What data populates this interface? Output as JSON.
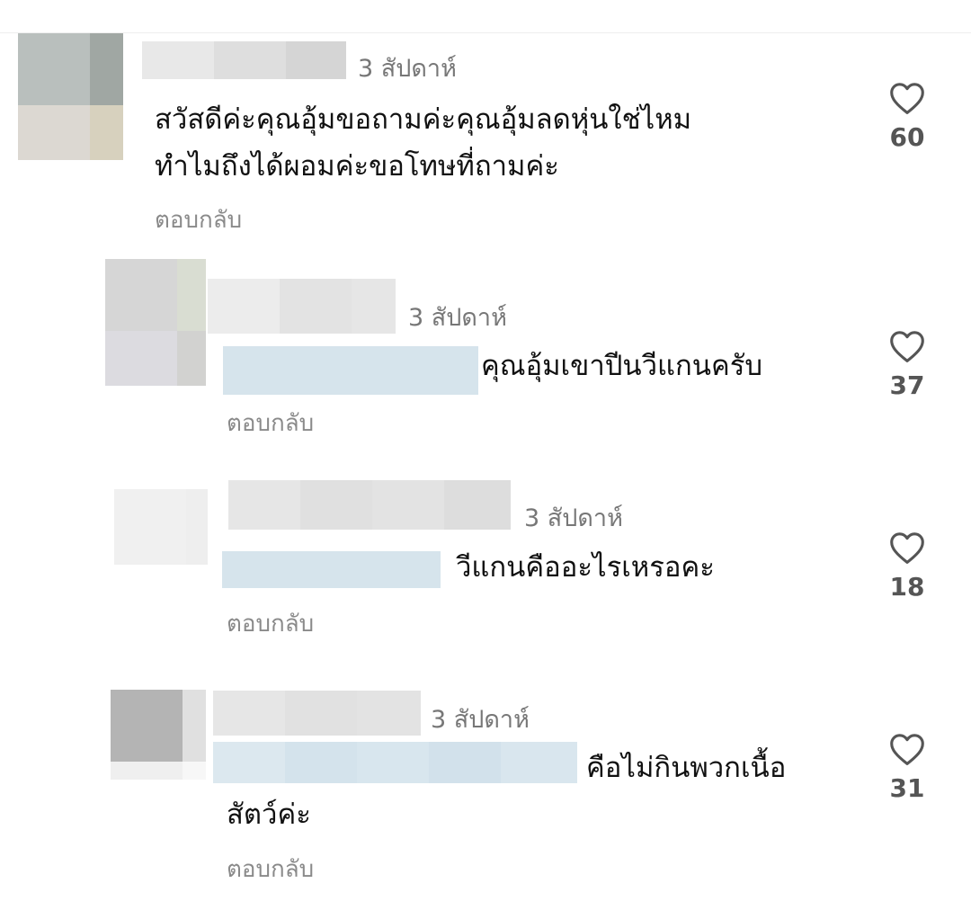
{
  "comments": [
    {
      "time": "3 สัปดาห์",
      "text": "สวัสดีค่ะคุณอุ้มขอถามค่ะคุณอุ้มลดหุ่นใช่ไหม\nทำไมถึงได้ผอมค่ะขอโทษที่ถามค่ะ",
      "reply_label": "ตอบกลับ",
      "likes": "60",
      "like_icon": "heart-outline-icon"
    },
    {
      "time": "3 สัปดาห์",
      "text": "คุณอุ้มเขาปีนวีแกนครับ",
      "reply_label": "ตอบกลับ",
      "likes": "37",
      "like_icon": "heart-outline-icon"
    },
    {
      "time": "3 สัปดาห์",
      "text": "วีแกนคืออะไรเหรอคะ",
      "reply_label": "ตอบกลับ",
      "likes": "18",
      "like_icon": "heart-outline-icon"
    },
    {
      "time": "3 สัปดาห์",
      "text": "คือไม่กินพวกเนื้อ",
      "text_line2": "สัตว์ค่ะ",
      "reply_label": "ตอบกลับ",
      "likes": "31",
      "like_icon": "heart-outline-icon"
    }
  ],
  "colors": {
    "mention_blur": "#d6e4ec",
    "name_blur": "#e2e2e2",
    "meta_text": "#777777"
  }
}
